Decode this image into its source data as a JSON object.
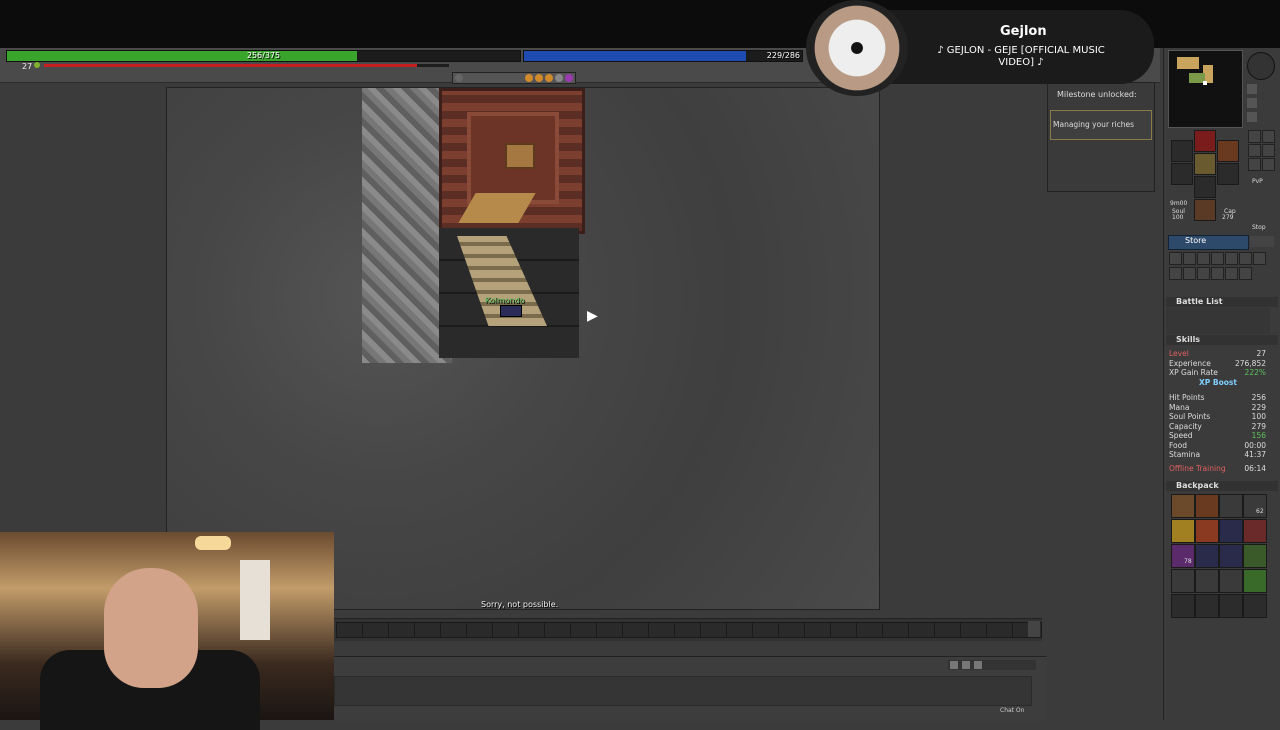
{
  "status": {
    "health_text": "256/375",
    "health_fraction": 0.683,
    "mana_text": "229/286",
    "mana_fraction": 0.8,
    "level_label": "27",
    "level_progress": 0.92
  },
  "music": {
    "artist": "Gejlon",
    "title": "♪ GEJLON - GEJE [OFFICIAL MUSIC VIDEO] ♪"
  },
  "milestone": {
    "title": "Milestone unlocked:",
    "text": "Managing your riches"
  },
  "game": {
    "character_name": "Kolmondo",
    "message": "Sorry, not possible."
  },
  "sidebar": {
    "store_label": "Store",
    "soul_label": "Soul",
    "soul_value": "100",
    "cap_label": "Cap",
    "cap_value": "279",
    "time_label": "9m00",
    "pvp_label": "PvP",
    "stop_label": "Stop"
  },
  "battle_list": {
    "title": "Battle List"
  },
  "skills": {
    "title": "Skills",
    "rows": [
      {
        "label": "Level",
        "value": "27"
      },
      {
        "label": "Experience",
        "value": "276,852"
      },
      {
        "label": "XP Gain Rate",
        "value": "222%"
      },
      {
        "label": "XP Boost",
        "value": ""
      },
      {
        "label": "Hit Points",
        "value": "256"
      },
      {
        "label": "Mana",
        "value": "229"
      },
      {
        "label": "Soul Points",
        "value": "100"
      },
      {
        "label": "Capacity",
        "value": "279"
      },
      {
        "label": "Speed",
        "value": "156"
      },
      {
        "label": "Food",
        "value": "00:00"
      },
      {
        "label": "Stamina",
        "value": "41:37"
      },
      {
        "label": "Offline Training",
        "value": "06:14"
      }
    ]
  },
  "backpack": {
    "title": "Backpack",
    "stack_labels": [
      "62",
      "78"
    ]
  },
  "chat": {
    "on_label": "Chat On"
  }
}
